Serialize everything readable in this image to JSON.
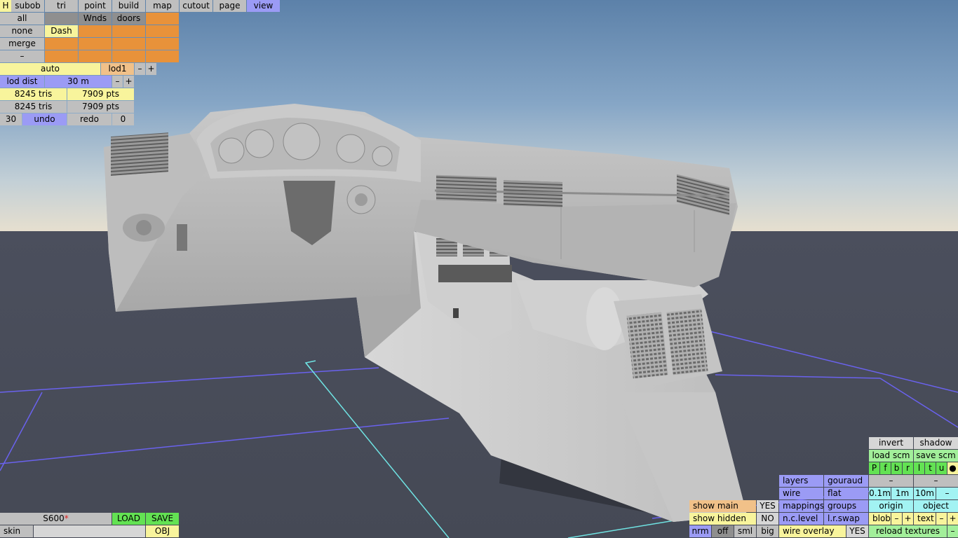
{
  "top_menu": {
    "h": "H",
    "subob": "subob",
    "tri": "tri",
    "point": "point",
    "build": "build",
    "map": "map",
    "cutout": "cutout",
    "page": "page",
    "view": "view"
  },
  "subobject_panel": {
    "all": "all",
    "none": "none",
    "merge": "merge",
    "minus": "–",
    "wnds": "Wnds",
    "doors": "doors",
    "dash": "Dash"
  },
  "lod": {
    "mode": "auto",
    "level": "lod1",
    "minus": "–",
    "plus": "+",
    "dist_label": "lod dist",
    "dist_value": "30 m",
    "dist_minus": "–",
    "dist_plus": "+"
  },
  "stats": {
    "tris_1": "8245 tris",
    "pts_1": "7909 pts",
    "tris_2": "8245 tris",
    "pts_2": "7909 pts"
  },
  "undo": {
    "count": "30",
    "undo": "undo",
    "redo": "redo",
    "redo_count": "0"
  },
  "file": {
    "name": "S600",
    "modified": "*",
    "load": "LOAD",
    "save": "SAVE",
    "skin": "skin",
    "skin_value": "",
    "obj": "OBJ"
  },
  "view_panel": {
    "invert": "invert",
    "shadow": "shadow",
    "load_scm": "load scm",
    "save_scm": "save scm",
    "flags": [
      "P",
      "f",
      "b",
      "r",
      "l",
      "t",
      "u",
      "●"
    ],
    "layers": "layers",
    "gouraud": "gouraud",
    "wire": "wire",
    "flat": "flat",
    "dash_a": "–",
    "dash_b": "–",
    "step_01": "0.1m",
    "step_1": "1m",
    "step_10": "10m",
    "step_minus": "–",
    "mappings": "mappings",
    "groups": "groups",
    "origin": "origin",
    "object": "object",
    "nc_level": "n.c.level",
    "lr_swap": "l.r.swap",
    "blob": "blob",
    "blob_minus": "–",
    "blob_plus": "+",
    "text": "text",
    "text_minus": "–",
    "text_plus": "+",
    "wire_overlay": "wire overlay",
    "wire_overlay_value": "YES",
    "reload_textures": "reload textures",
    "reload_minus": "–"
  },
  "show_panel": {
    "show_main": "show main",
    "show_main_value": "YES",
    "show_hidden": "show hidden",
    "show_hidden_value": "NO",
    "nrm": "nrm",
    "off": "off",
    "sml": "sml",
    "big": "big"
  }
}
